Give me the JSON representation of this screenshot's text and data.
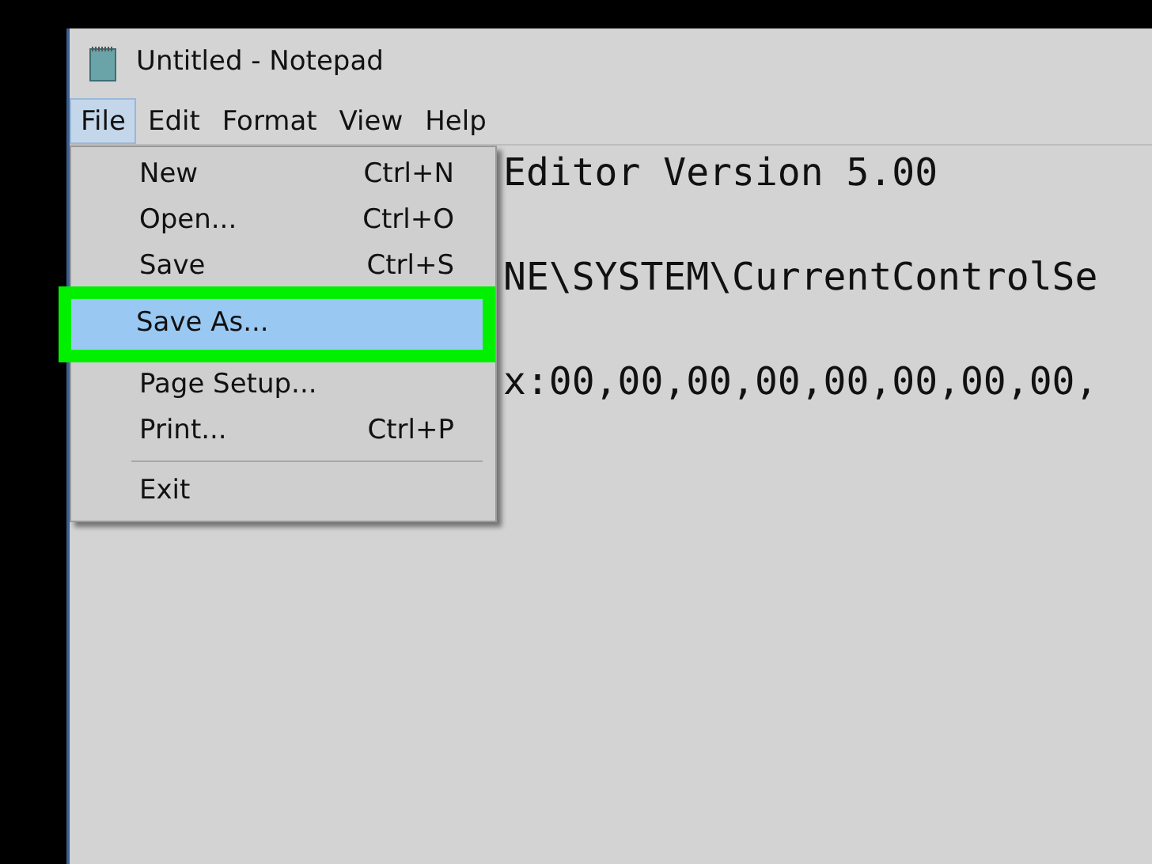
{
  "window": {
    "title": "Untitled - Notepad"
  },
  "menu_bar": [
    {
      "label": "File",
      "selected": true
    },
    {
      "label": "Edit",
      "selected": false
    },
    {
      "label": "Format",
      "selected": false
    },
    {
      "label": "View",
      "selected": false
    },
    {
      "label": "Help",
      "selected": false
    }
  ],
  "file_menu": [
    {
      "kind": "item",
      "label": "New",
      "shortcut": "Ctrl+N",
      "selected": false,
      "highlighted": false
    },
    {
      "kind": "item",
      "label": "Open...",
      "shortcut": "Ctrl+O",
      "selected": false,
      "highlighted": false
    },
    {
      "kind": "item",
      "label": "Save",
      "shortcut": "Ctrl+S",
      "selected": false,
      "highlighted": false
    },
    {
      "kind": "item",
      "label": "Save As...",
      "selected": true,
      "highlighted": true
    },
    {
      "kind": "item",
      "label": "Page Setup...",
      "selected": false,
      "highlighted": false
    },
    {
      "kind": "item",
      "label": "Print...",
      "shortcut": "Ctrl+P",
      "selected": false,
      "highlighted": false
    },
    {
      "kind": "separator"
    },
    {
      "kind": "item",
      "label": "Exit",
      "selected": false,
      "highlighted": false
    }
  ],
  "editor": {
    "lines": [
      "Editor Version 5.00",
      "NE\\SYSTEM\\CurrentControlSe",
      "x:00,00,00,00,00,00,00,00,"
    ]
  }
}
